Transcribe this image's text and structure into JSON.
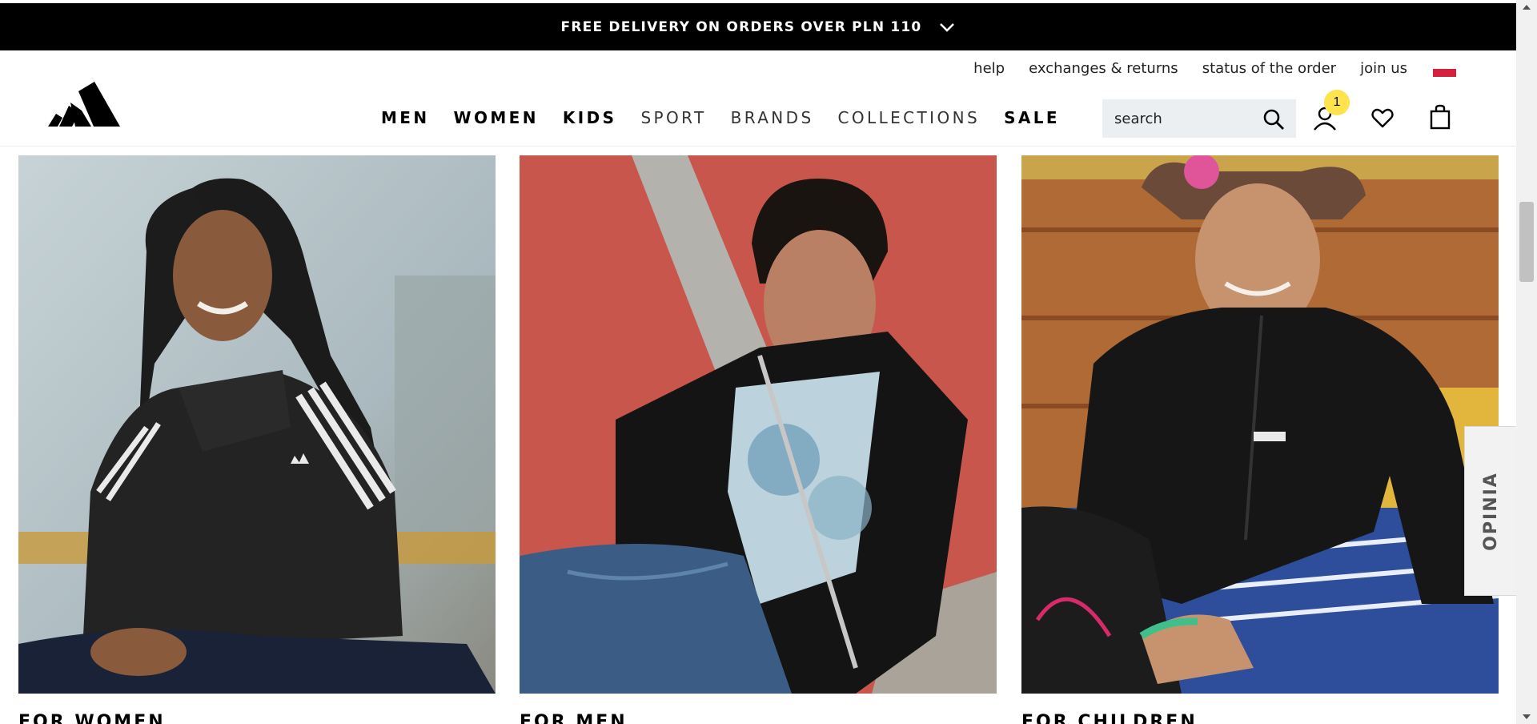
{
  "promo": {
    "text": "FREE DELIVERY ON ORDERS OVER PLN 110"
  },
  "utility_links": [
    "help",
    "exchanges & returns",
    "status of the order",
    "join us"
  ],
  "nav": [
    "MEN",
    "WOMEN",
    "KIDS",
    "SPORT",
    "BRANDS",
    "COLLECTIONS",
    "SALE"
  ],
  "search": {
    "placeholder": "search"
  },
  "account": {
    "badge_count": "1"
  },
  "cards": [
    {
      "caption": "FOR WOMEN"
    },
    {
      "caption": "FOR MEN"
    },
    {
      "caption": "FOR CHILDREN"
    }
  ],
  "feedback": {
    "label": "OPINIA"
  },
  "colors": {
    "promo_bg": "#000000",
    "badge": "#fde34c",
    "flag_red": "#d4213d",
    "search_bg": "#eceff1"
  },
  "icons": [
    "adidas-logo",
    "chevron-down-icon",
    "search-icon",
    "account-icon",
    "heart-icon",
    "bag-icon",
    "poland-flag-icon"
  ]
}
